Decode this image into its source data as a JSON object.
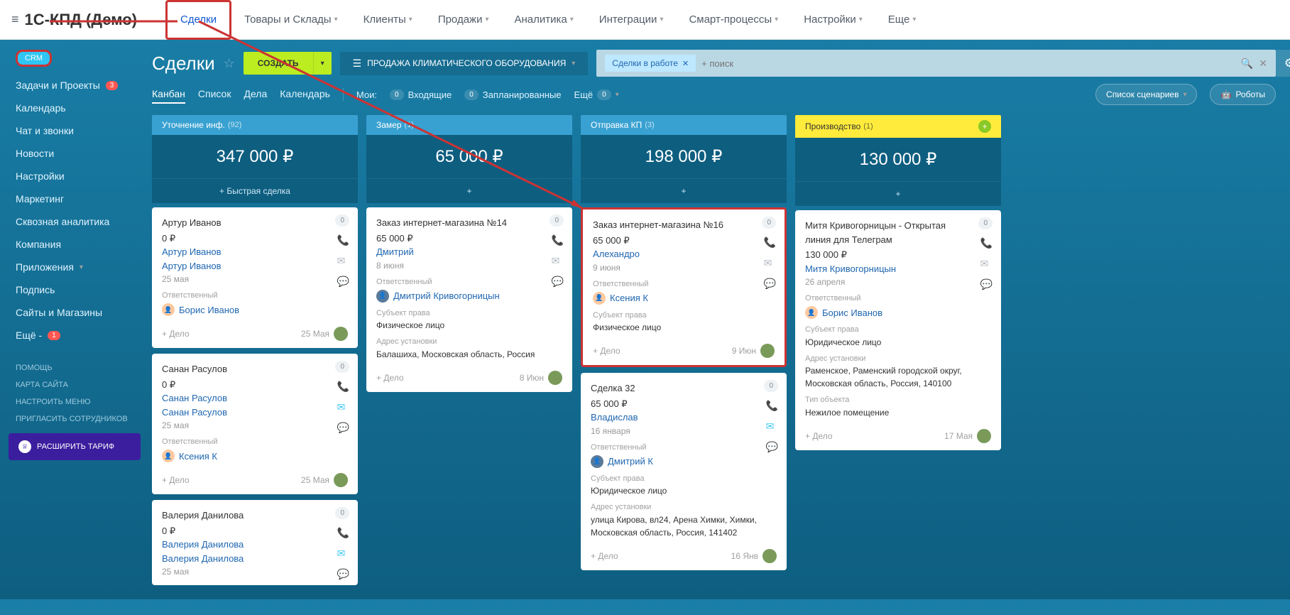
{
  "brand": "1С-КПД (Демо)",
  "nav": [
    "Сделки",
    "Товары и Склады",
    "Клиенты",
    "Продажи",
    "Аналитика",
    "Интеграции",
    "Смарт-процессы",
    "Настройки",
    "Еще"
  ],
  "navHasChev": [
    false,
    true,
    true,
    true,
    true,
    true,
    true,
    true,
    true
  ],
  "sidebarTag": "CRM",
  "sidebar": {
    "items": [
      {
        "label": "Задачи и Проекты",
        "badge": "3"
      },
      {
        "label": "Календарь"
      },
      {
        "label": "Чат и звонки"
      },
      {
        "label": "Новости"
      },
      {
        "label": "Настройки"
      },
      {
        "label": "Маркетинг"
      },
      {
        "label": "Сквозная аналитика"
      },
      {
        "label": "Компания"
      },
      {
        "label": "Приложения",
        "chev": true
      },
      {
        "label": "Подпись"
      },
      {
        "label": "Сайты и Магазины"
      },
      {
        "label": "Ещё -",
        "badge": "1"
      }
    ],
    "small": [
      "ПОМОЩЬ",
      "КАРТА САЙТА",
      "НАСТРОИТЬ МЕНЮ",
      "ПРИГЛАСИТЬ СОТРУДНИКОВ"
    ],
    "expand": "РАСШИРИТЬ ТАРИФ"
  },
  "page": {
    "title": "Сделки",
    "create": "СОЗДАТЬ",
    "filterText": "ПРОДАЖА КЛИМАТИЧЕСКОГО ОБОРУДОВАНИЯ",
    "chip": "Сделки в работе",
    "searchPlaceholder": "+ поиск"
  },
  "viewTabs": [
    "Канбан",
    "Список",
    "Дела",
    "Календарь"
  ],
  "viewPills": {
    "my": "Мои:",
    "incoming": "Входящие",
    "incomingCount": "0",
    "planned": "Запланированные",
    "plannedCount": "0",
    "more": "Ещё",
    "moreCount": "0"
  },
  "buttons": {
    "scenarios": "Список сценариев",
    "robots": "Роботы"
  },
  "columns": [
    {
      "title": "Уточнение инф.",
      "count": "(92)",
      "sum": "347 000 ₽",
      "quick": "+  Быстрая сделка",
      "style": "blue"
    },
    {
      "title": "Замер",
      "count": "(1)",
      "sum": "65 000 ₽",
      "quick": "+",
      "style": "blue"
    },
    {
      "title": "Отправка КП",
      "count": "(3)",
      "sum": "198 000 ₽",
      "quick": "+",
      "style": "blue"
    },
    {
      "title": "Производство",
      "count": "(1)",
      "sum": "130 000 ₽",
      "quick": "+",
      "style": "yellow",
      "addBtn": true
    }
  ],
  "cards": {
    "c0": [
      {
        "title": "Артур Иванов",
        "price": "0 ₽",
        "links": [
          "Артур Иванов",
          "Артур Иванов"
        ],
        "date": "25 мая",
        "respLabel": "Ответственный",
        "resp": "Борис Иванов",
        "foot": "+ Дело",
        "footDate": "25 Мая",
        "count": "0"
      },
      {
        "title": "Санан Расулов",
        "price": "0 ₽",
        "links": [
          "Санан Расулов",
          "Санан Расулов"
        ],
        "date": "25 мая",
        "respLabel": "Ответственный",
        "resp": "Ксения К",
        "foot": "+ Дело",
        "footDate": "25 Мая",
        "count": "0",
        "mailBlue": true
      },
      {
        "title": "Валерия Данилова",
        "price": "0 ₽",
        "links": [
          "Валерия Данилова",
          "Валерия Данилова"
        ],
        "date": "25 мая",
        "count": "0",
        "mailBlue": true
      }
    ],
    "c1": [
      {
        "title": "Заказ интернет-магазина №14",
        "price": "65 000 ₽",
        "links": [
          "Дмитрий"
        ],
        "date": "8 июня",
        "respLabel": "Ответственный",
        "resp": "Дмитрий Кривогорницын",
        "subjLabel": "Субъект права",
        "subj": "Физическое лицо",
        "addrLabel": "Адрес установки",
        "addr": "Балашиха, Московская область, Россия",
        "foot": "+ Дело",
        "footDate": "8 Июн",
        "count": "0",
        "photoAv": true
      }
    ],
    "c2": [
      {
        "title": "Заказ интернет-магазина №16",
        "price": "65 000 ₽",
        "links": [
          "Алехандро"
        ],
        "date": "9 июня",
        "respLabel": "Ответственный",
        "resp": "Ксения К",
        "subjLabel": "Субъект права",
        "subj": "Физическое лицо",
        "foot": "+ Дело",
        "footDate": "9 Июн",
        "count": "0",
        "red": true
      },
      {
        "title": "Сделка 32",
        "price": "65 000 ₽",
        "links": [
          "Владислав"
        ],
        "date": "16 января",
        "respLabel": "Ответственный",
        "resp": "Дмитрий К",
        "subjLabel": "Субъект права",
        "subj": "Юридическое лицо",
        "addrLabel": "Адрес установки",
        "addr": "улица Кирова, вл24, Арена Химки, Химки, Московская область, Россия, 141402",
        "foot": "+ Дело",
        "footDate": "16 Янв",
        "count": "0",
        "mailBlue": true,
        "photoAv": true
      }
    ],
    "c3": [
      {
        "title": "Митя Кривогорницын - Открытая линия для Телеграм",
        "price": "130 000 ₽",
        "links": [
          "Митя Кривогорницын"
        ],
        "date": "26 апреля",
        "respLabel": "Ответственный",
        "resp": "Борис Иванов",
        "subjLabel": "Субъект права",
        "subj": "Юридическое лицо",
        "addrLabel": "Адрес установки",
        "addr": "Раменское, Раменский городской округ, Московская область, Россия, 140100",
        "typeLabel": "Тип объекта",
        "type": "Нежилое помещение",
        "foot": "+ Дело",
        "footDate": "17 Мая",
        "count": "0",
        "chatBlue": true
      }
    ]
  }
}
